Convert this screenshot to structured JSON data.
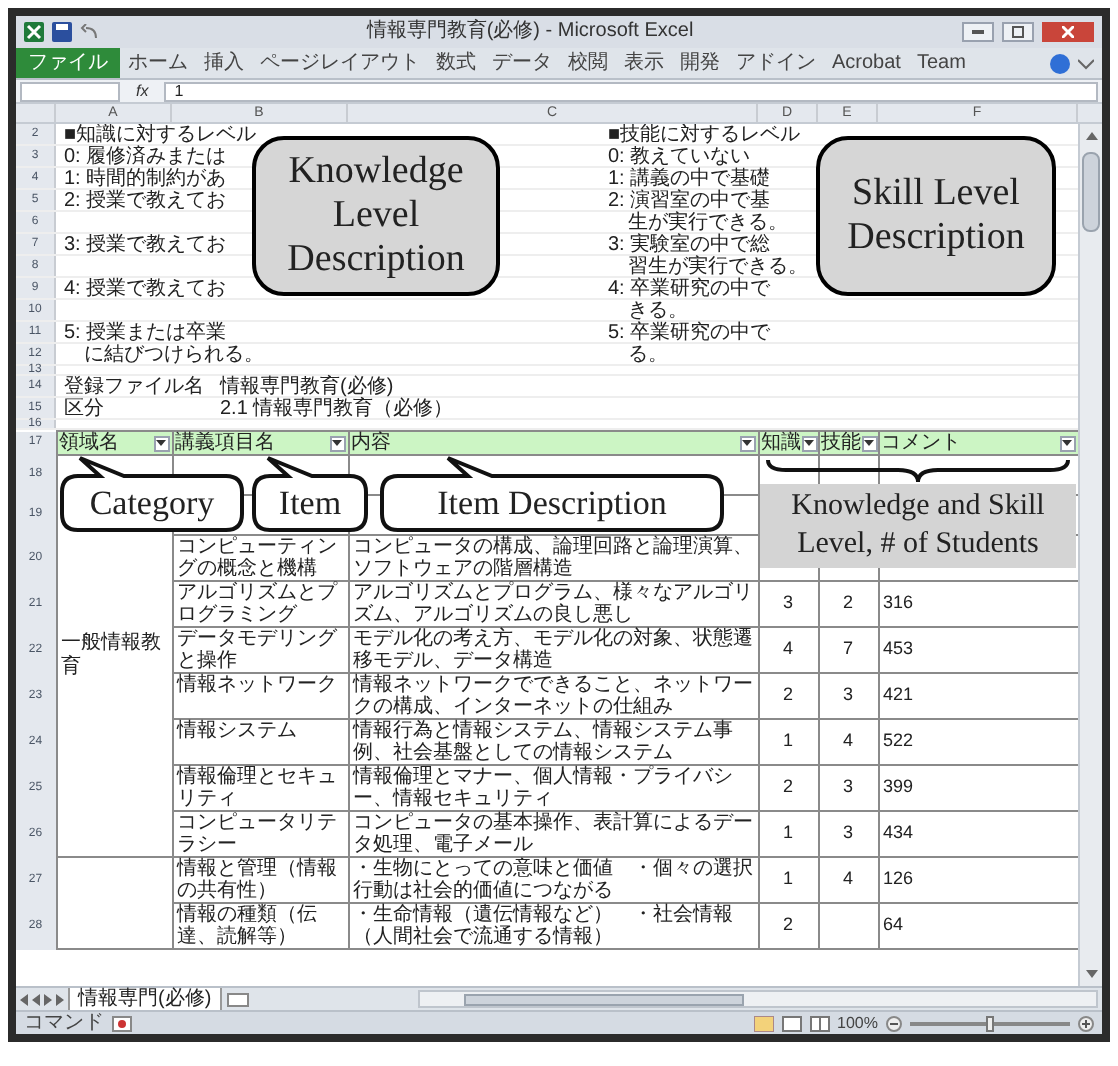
{
  "window": {
    "title": "情報専門教育(必修) - Microsoft Excel"
  },
  "ribbon_tabs": [
    {
      "label": "ファイル",
      "kind": "file"
    },
    {
      "label": "ホーム",
      "kind": "tab"
    },
    {
      "label": "挿入",
      "kind": "tab"
    },
    {
      "label": "ページレイアウト",
      "kind": "tab"
    },
    {
      "label": "数式",
      "kind": "tab"
    },
    {
      "label": "データ",
      "kind": "tab"
    },
    {
      "label": "校閲",
      "kind": "tab"
    },
    {
      "label": "表示",
      "kind": "tab"
    },
    {
      "label": "開発",
      "kind": "tab"
    },
    {
      "label": "アドイン",
      "kind": "tab"
    },
    {
      "label": "Acrobat",
      "kind": "tab"
    },
    {
      "label": "Team",
      "kind": "tab"
    }
  ],
  "formula_bar": {
    "fx": "fx",
    "value": "1"
  },
  "column_headers": [
    "A",
    "B",
    "C",
    "D",
    "E",
    "F"
  ],
  "level_rows": [
    {
      "row": "2",
      "knowledge": "■知識に対するレベル",
      "skill": "■技能に対するレベル"
    },
    {
      "row": "3",
      "knowledge": "0: 履修済みまたは",
      "skill": "0: 教えていない"
    },
    {
      "row": "4",
      "knowledge": "1: 時間的制約があ",
      "skill": "1: 講義の中で基礎"
    },
    {
      "row": "5",
      "knowledge": "2: 授業で教えてお",
      "skill": "2: 演習室の中で基"
    },
    {
      "row": "6",
      "skill": "　生が実行できる。"
    },
    {
      "row": "7",
      "knowledge": "3: 授業で教えてお",
      "skill": "3: 実験室の中で総"
    },
    {
      "row": "8",
      "skill": "　習生が実行できる。"
    },
    {
      "row": "9",
      "knowledge": "4: 授業で教えてお",
      "skill": "4: 卒業研究の中で"
    },
    {
      "row": "10",
      "skill": "　きる。"
    },
    {
      "row": "11",
      "knowledge": "5: 授業または卒業",
      "skill": "5: 卒業研究の中で"
    },
    {
      "row": "12",
      "knowledge": "　に結びつけられる。",
      "skill": "　る。"
    },
    {
      "row": "13"
    }
  ],
  "info_rows": [
    {
      "row": "14",
      "label": "登録ファイル名",
      "value": "情報専門教育(必修)"
    },
    {
      "row": "15",
      "label": "区分",
      "value": "2.1 情報専門教育（必修）"
    },
    {
      "row": "16"
    }
  ],
  "table": {
    "header_row": "17",
    "columns": [
      "領域名",
      "講義項目名",
      "内容",
      "知識",
      "技能",
      "コメント"
    ],
    "groups": [
      {
        "category": "一般情報教育",
        "rows": [
          {
            "row": "18"
          },
          {
            "row": "19"
          },
          {
            "row": "20",
            "item": "コンピューティングの概念と機構",
            "description": "コンピュータの構成、論理回路と論理演算、ソフトウェアの階層構造"
          },
          {
            "row": "21",
            "item": "アルゴリズムとプログラミング",
            "description": "アルゴリズムとプログラム、様々なアルゴリズム、アルゴリズムの良し悪し",
            "knowledge": "3",
            "skill": "2",
            "comment": "316"
          },
          {
            "row": "22",
            "item": "データモデリングと操作",
            "description": "モデル化の考え方、モデル化の対象、状態遷移モデル、データ構造",
            "knowledge": "4",
            "skill": "7",
            "comment": "453"
          },
          {
            "row": "23",
            "item": "情報ネットワーク",
            "description": "情報ネットワークでできること、ネットワークの構成、インターネットの仕組み",
            "knowledge": "2",
            "skill": "3",
            "comment": "421"
          },
          {
            "row": "24",
            "item": "情報システム",
            "description": "情報行為と情報システム、情報システム事例、社会基盤としての情報システム",
            "knowledge": "1",
            "skill": "4",
            "comment": "522"
          },
          {
            "row": "25",
            "item": "情報倫理とセキュリティ",
            "description": "情報倫理とマナー、個人情報・プライバシー、情報セキュリティ",
            "knowledge": "2",
            "skill": "3",
            "comment": "399"
          },
          {
            "row": "26",
            "item": "コンピュータリテラシー",
            "description": "コンピュータの基本操作、表計算によるデータ処理、電子メール",
            "knowledge": "1",
            "skill": "3",
            "comment": "434"
          }
        ]
      },
      {
        "rows": [
          {
            "row": "27",
            "item": "情報と管理（情報の共有性）",
            "description": "・生物にとっての意味と価値　・個々の選択行動は社会的価値につながる",
            "knowledge": "1",
            "skill": "4",
            "comment": "126"
          },
          {
            "row": "28",
            "item": "情報の種類（伝達、読解等）",
            "description": "・生命情報（遺伝情報など）　・社会情報（人間社会で流通する情報）",
            "knowledge": "2",
            "comment": "64"
          }
        ]
      }
    ]
  },
  "callouts": [
    {
      "kind": "box",
      "text": "Knowledge Level Description"
    },
    {
      "kind": "box",
      "text": "Skill Level Description"
    },
    {
      "kind": "bubble",
      "text": "Category"
    },
    {
      "kind": "bubble",
      "text": "Item"
    },
    {
      "kind": "bubble",
      "text": "Item Description"
    },
    {
      "kind": "brace",
      "text": "Knowledge and Skill Level, # of Students"
    }
  ],
  "sheet_tabs": [
    {
      "label": "情報専門(必修)",
      "selected": true
    }
  ],
  "status_bar": {
    "mode": "コマンド",
    "zoom": "100%",
    "zoom_slider": {
      "level": 0.5
    }
  }
}
